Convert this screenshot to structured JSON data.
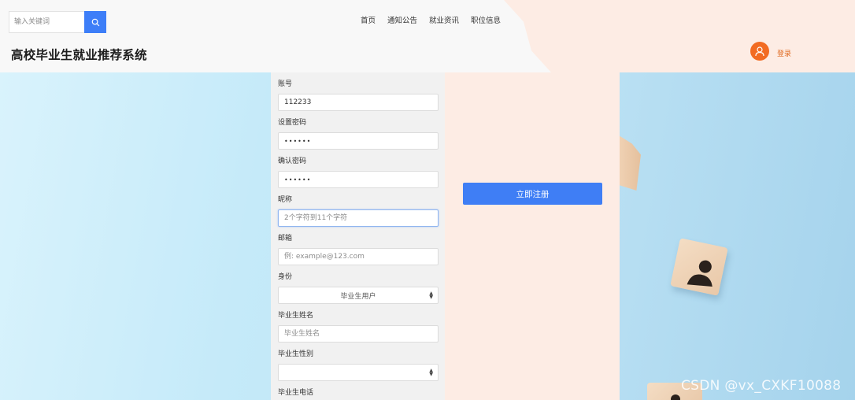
{
  "header": {
    "search": {
      "placeholder": "输入关键词"
    },
    "nav": [
      "首页",
      "通知公告",
      "就业资讯",
      "职位信息"
    ],
    "title": "高校毕业生就业推荐系统",
    "login_label": "登录"
  },
  "form": {
    "account": {
      "label": "账号",
      "value": "112233"
    },
    "password": {
      "label": "设置密码",
      "value": "••••••"
    },
    "confirm_password": {
      "label": "确认密码",
      "value": "••••••"
    },
    "nickname": {
      "label": "昵称",
      "placeholder": "2个字符到11个字符"
    },
    "email": {
      "label": "邮箱",
      "placeholder": "例: example@123.com"
    },
    "role": {
      "label": "身份",
      "selected": "毕业生用户"
    },
    "graduate_name": {
      "label": "毕业生姓名",
      "placeholder": "毕业生姓名"
    },
    "graduate_gender": {
      "label": "毕业生性别",
      "selected": ""
    },
    "graduate_phone": {
      "label": "毕业生电话"
    }
  },
  "submit_label": "立即注册",
  "watermark": "CSDN @vx_CXKF10088",
  "colors": {
    "accent": "#3d7ef8",
    "orange": "#f26b22",
    "panel_peach": "#fdece4",
    "panel_gray": "#f1f1f1"
  },
  "icons": {
    "search": "search-icon",
    "avatar": "user-icon",
    "select": "select-arrows-icon"
  }
}
